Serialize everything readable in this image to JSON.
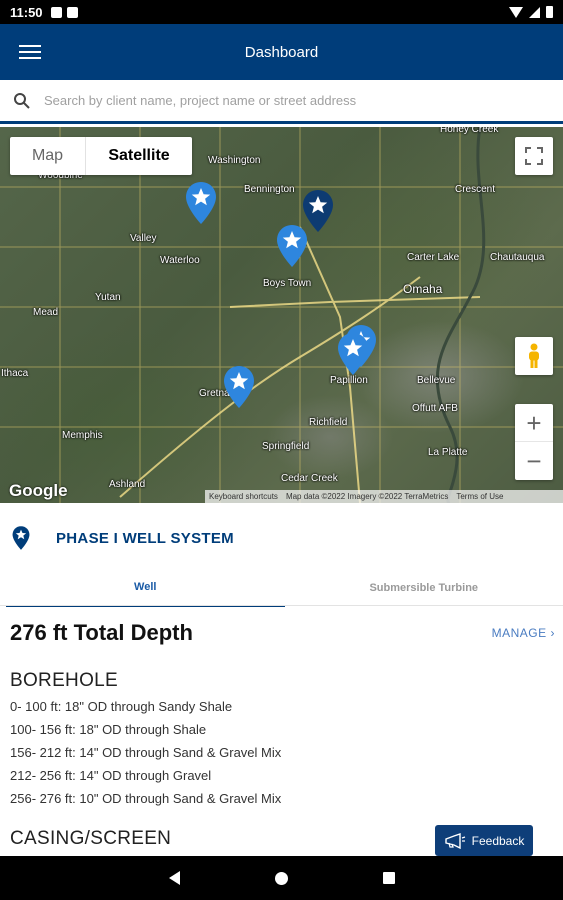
{
  "status_bar": {
    "time": "11:50"
  },
  "app_bar": {
    "title": "Dashboard",
    "menu_icon": "hamburger-menu-icon"
  },
  "search": {
    "placeholder": "Search by client name, project name or street address",
    "value": ""
  },
  "map": {
    "type_toggle": {
      "map_label": "Map",
      "satellite_label": "Satellite",
      "selected": "Satellite"
    },
    "labels": [
      "Honey Creek",
      "Washington",
      "Woodbine",
      "Bennington",
      "Crescent",
      "Valley",
      "Waterloo",
      "Carter Lake",
      "Chautauqua",
      "Boys Town",
      "Omaha",
      "Yutan",
      "Mead",
      "Papillion",
      "Bellevue",
      "Offutt AFB",
      "Richfield",
      "Memphis",
      "Springfield",
      "La Platte",
      "Cedar Creek",
      "Ashland",
      "Gretna",
      "Ithaca"
    ],
    "google_logo": "Google",
    "attribution": [
      "Keyboard shortcuts",
      "Map data ©2022 Imagery ©2022 TerraMetrics",
      "Terms of Use"
    ],
    "zoom_in": "+",
    "zoom_out": "−",
    "pin_accent": "#2e86de",
    "selected_pin_color": "#0d3b72"
  },
  "project": {
    "title": "PHASE I WELL SYSTEM"
  },
  "tabs": [
    {
      "label": "Well",
      "active": true
    },
    {
      "label": "Submersible Turbine",
      "active": false
    }
  ],
  "well": {
    "depth_title": "276 ft Total Depth",
    "manage_label": "MANAGE",
    "borehole_heading": "BOREHOLE",
    "borehole": [
      "0- 100 ft: 18\" OD through Sandy Shale",
      "100- 156 ft: 18\" OD through Shale",
      "156- 212 ft: 14\" OD through Sand & Gravel Mix",
      "212- 256 ft: 14\" OD through Gravel",
      "256- 276 ft: 10\" OD through Sand & Gravel Mix"
    ],
    "casing_heading": "CASING/SCREEN"
  },
  "feedback": {
    "label": "Feedback"
  },
  "colors": {
    "primary": "#003d7a",
    "link": "#4a7cc1"
  }
}
